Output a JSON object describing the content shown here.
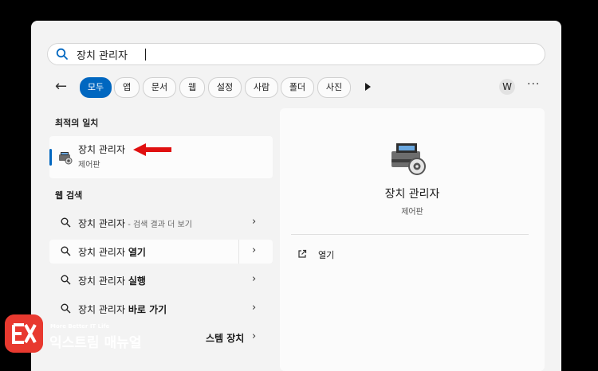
{
  "search": {
    "query": "장치 관리자"
  },
  "filters": [
    {
      "label": "모두",
      "active": true
    },
    {
      "label": "앱"
    },
    {
      "label": "문서"
    },
    {
      "label": "웹"
    },
    {
      "label": "설정"
    },
    {
      "label": "사람"
    },
    {
      "label": "폴더"
    },
    {
      "label": "사진"
    }
  ],
  "account_initial": "W",
  "more_label": "···",
  "best_match": {
    "heading": "최적의 일치",
    "title": "장치 관리자",
    "subtitle": "제어판"
  },
  "web_search": {
    "heading": "웹 검색",
    "items": [
      {
        "text": "장치 관리자",
        "suffix": " - 검색 결과 더 보기",
        "bold": ""
      },
      {
        "text": "장치 관리자 ",
        "bold": "열기"
      },
      {
        "text": "장치 관리자 ",
        "bold": "실행"
      },
      {
        "text": "장치 관리자 ",
        "bold": "바로 가기"
      },
      {
        "text": "",
        "bold": "스템 장치"
      }
    ]
  },
  "detail": {
    "title": "장치 관리자",
    "subtitle": "제어판",
    "actions": [
      {
        "label": "열기"
      }
    ]
  },
  "watermark": {
    "tagline": "More Better IT Life",
    "name": "익스트림 매뉴얼"
  },
  "colors": {
    "accent": "#0067c0",
    "arrow": "#e01010",
    "logo": "#e8392f"
  },
  "icons": [
    "search-icon",
    "back-arrow-icon",
    "play-icon",
    "more-icon",
    "device-manager-icon",
    "chevron-right-icon",
    "open-external-icon"
  ]
}
